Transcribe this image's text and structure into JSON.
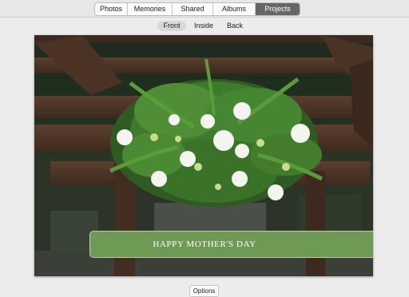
{
  "tabs": [
    "Photos",
    "Memories",
    "Shared",
    "Albums",
    "Projects"
  ],
  "active_tab": "Projects",
  "card_views": [
    "Front",
    "Inside",
    "Back"
  ],
  "active_view": "Front",
  "card": {
    "banner_text": "HAPPY MOTHER'S DAY"
  },
  "footer": {
    "options_label": "Options"
  },
  "colors": {
    "active_tab_bg": "#666666",
    "banner_green": "#6e9a56",
    "toolbar_bg": "#e7e7e7"
  }
}
